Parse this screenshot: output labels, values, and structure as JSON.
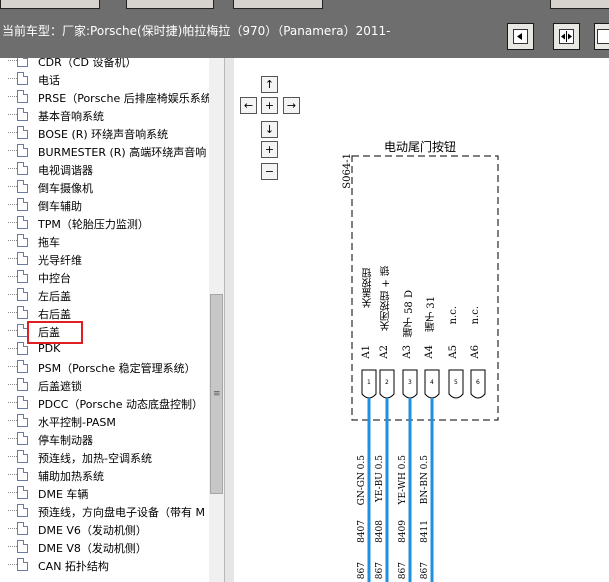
{
  "top_bar": {
    "vehicle_label": "当前车型：厂家:Porsche(保时捷)帕拉梅拉（970）（Panamera）2011-"
  },
  "tree": {
    "items": [
      "CDR（CD 设备机）",
      "电话",
      "PRSE（Porsche 后排座椅娱乐系统）",
      "基本音响系统",
      "BOSE (R) 环绕声音响系统",
      "BURMESTER (R) 高端环绕声音响",
      "电视调谐器",
      "倒车摄像机",
      "倒车辅助",
      "TPM（轮胎压力监测）",
      "拖车",
      "光导纤维",
      "中控台",
      "左后盖",
      "右后盖",
      "后盖",
      "PDK",
      "PSM（Porsche 稳定管理系统）",
      "后盖遮锁",
      "PDCC（Porsche 动态底盘控制）",
      "水平控制-PASM",
      "停车制动器",
      "预连线，加热-空调系统",
      "辅助加热系统",
      "DME 车辆",
      "预连线，方向盘电子设备（带有 M",
      "DME V6（发动机侧）",
      "DME V8（发动机侧）",
      "CAN 拓扑结构"
    ],
    "selected_index": 15
  },
  "diagram": {
    "component_title": "电动尾门按钮",
    "component_id": "S064-1",
    "pin_functions": [
      "关盖按钮",
      "关闭按钮 + 锁",
      "端子 58 D",
      "端子 31",
      "n.c.",
      "n.c."
    ],
    "pins": [
      "A1",
      "A2",
      "A3",
      "A4",
      "A5",
      "A6"
    ],
    "connector_numbers": [
      "1",
      "2",
      "3",
      "4",
      "5",
      "6"
    ],
    "wire_colors": [
      "GN-GN 0.5",
      "YE-BU 0.5",
      "YE-WH 0.5",
      "BN-BN 0.5"
    ],
    "wire_ids": [
      "8407",
      "8408",
      "8409",
      "8411"
    ],
    "wire_ref": [
      "867",
      "867",
      "867",
      "867"
    ],
    "wire_color_hex": "#1e90e0"
  },
  "nav": {
    "up": "↑",
    "left": "←",
    "center": "+",
    "right": "→",
    "down": "↓",
    "zoom_in": "+",
    "zoom_out": "−"
  },
  "scrollbar": {
    "grip": "≡"
  }
}
